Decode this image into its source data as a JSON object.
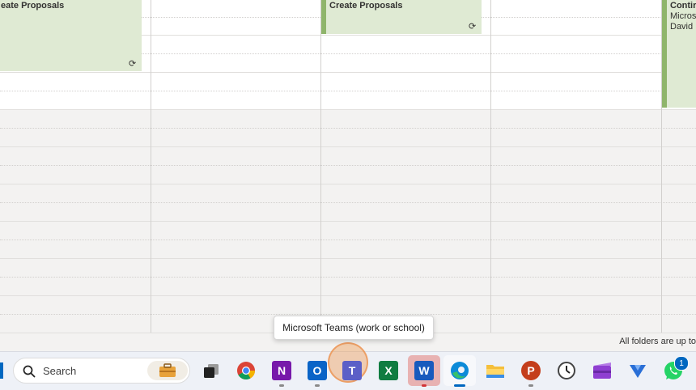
{
  "calendar": {
    "events": [
      {
        "title": "eate Proposals",
        "recurring_icon": "⟳"
      },
      {
        "title": "Create Proposals",
        "recurring_icon": "⟳"
      },
      {
        "title": "Contir",
        "line2": "Micros",
        "line3": "David"
      }
    ]
  },
  "status": {
    "text": "All folders are up to"
  },
  "tooltip": {
    "text": "Microsoft Teams (work or school)"
  },
  "taskbar": {
    "search_label": "Search",
    "apps": [
      {
        "icon": "briefcase-icon"
      },
      {
        "icon": "task-view-icon"
      },
      {
        "icon": "chrome-icon"
      },
      {
        "icon": "onenote-icon",
        "label": "N"
      },
      {
        "icon": "outlook-icon",
        "label": "O"
      },
      {
        "icon": "teams-icon",
        "label": "T"
      },
      {
        "icon": "excel-icon",
        "label": "X"
      },
      {
        "icon": "word-icon",
        "label": "W"
      },
      {
        "icon": "edge-icon"
      },
      {
        "icon": "file-explorer-icon"
      },
      {
        "icon": "powerpoint-icon",
        "label": "P"
      },
      {
        "icon": "clock-icon"
      },
      {
        "icon": "clipchamp-icon"
      },
      {
        "icon": "viva-icon"
      },
      {
        "icon": "whatsapp-icon"
      }
    ],
    "whatsapp_badge": "1"
  },
  "colors": {
    "event_bg": "#dfead3",
    "event_bar": "#8fb56b",
    "accent": "#0067c0"
  }
}
